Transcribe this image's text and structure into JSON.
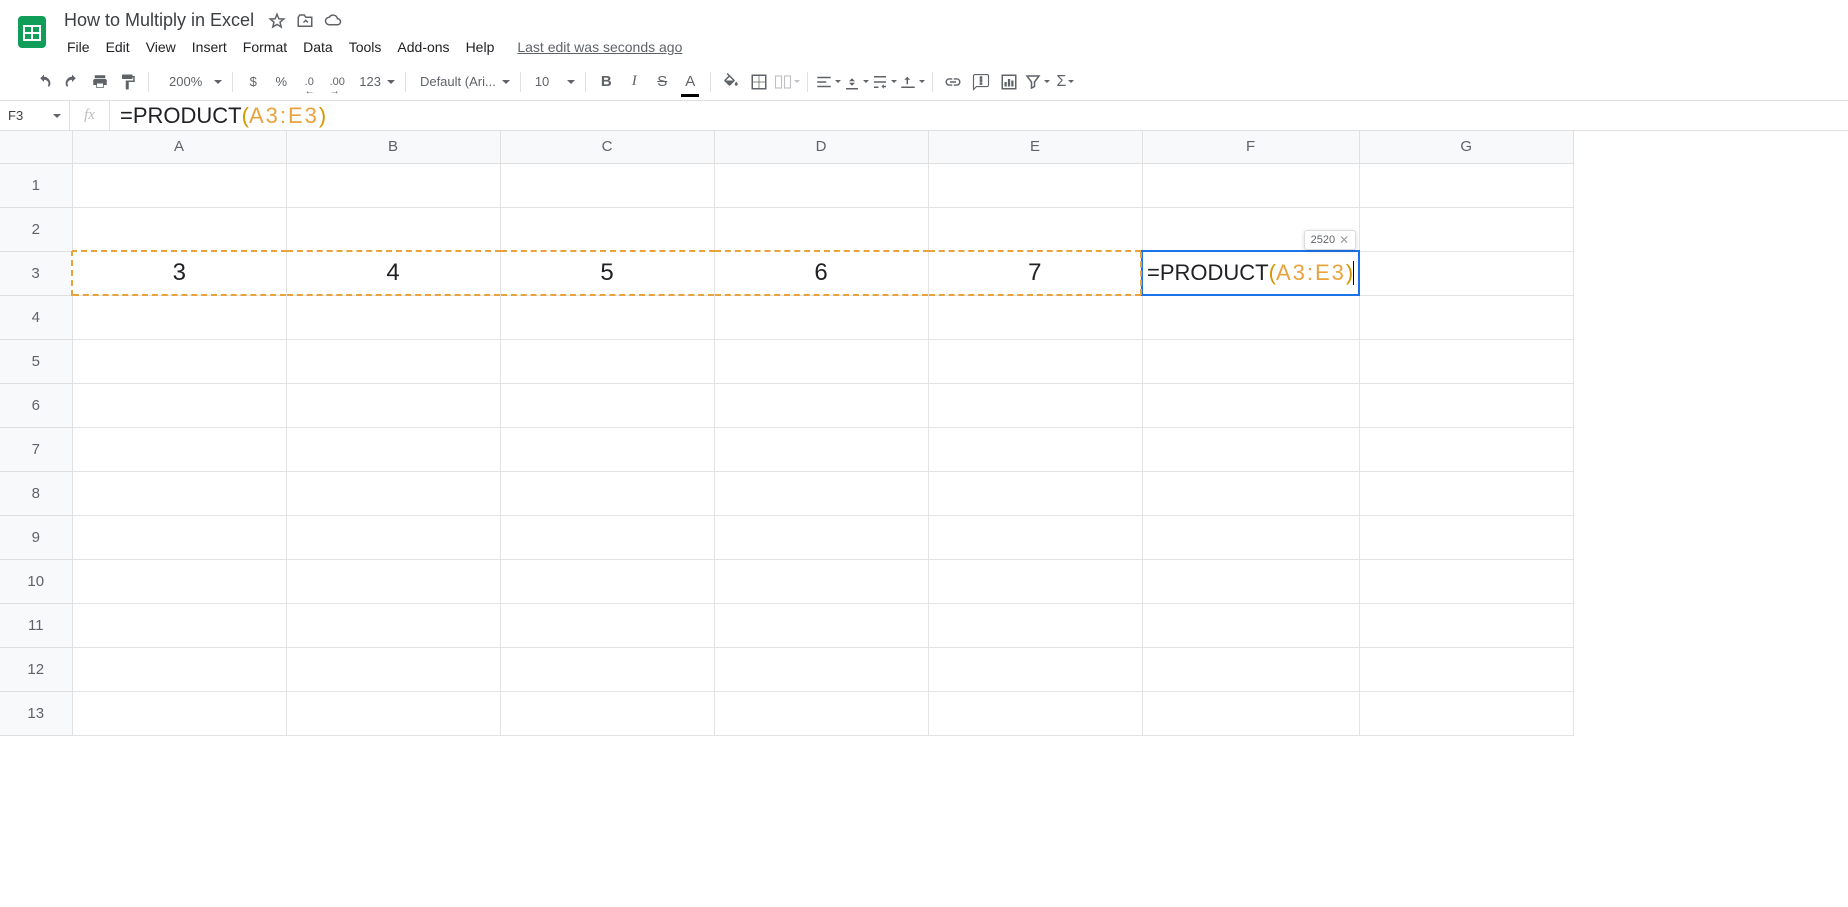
{
  "doc": {
    "title": "How to Multiply in Excel"
  },
  "menubar": {
    "items": [
      "File",
      "Edit",
      "View",
      "Insert",
      "Format",
      "Data",
      "Tools",
      "Add-ons",
      "Help"
    ],
    "last_edit": "Last edit was seconds ago"
  },
  "toolbar": {
    "zoom": "200%",
    "currency": "$",
    "percent": "%",
    "dec_less": ".0",
    "dec_more": ".00",
    "fmt123": "123",
    "font": "Default (Ari...",
    "fontsize": "10"
  },
  "formula_bar": {
    "name_box": "F3",
    "prefix": "=PRODUCT",
    "lparen": "(",
    "range": "A3:E3",
    "rparen": ")"
  },
  "preview": {
    "value": "2520"
  },
  "columns": [
    "A",
    "B",
    "C",
    "D",
    "E",
    "F",
    "G"
  ],
  "rows": [
    "1",
    "2",
    "3",
    "4",
    "5",
    "6",
    "7",
    "8",
    "9",
    "10",
    "11",
    "12",
    "13"
  ],
  "data": {
    "A3": "3",
    "B3": "4",
    "C3": "5",
    "D3": "6",
    "E3": "7"
  },
  "cell_formula": {
    "prefix": "=PRODUCT",
    "lparen": "(",
    "range": "A3:E3",
    "rparen": ")"
  }
}
